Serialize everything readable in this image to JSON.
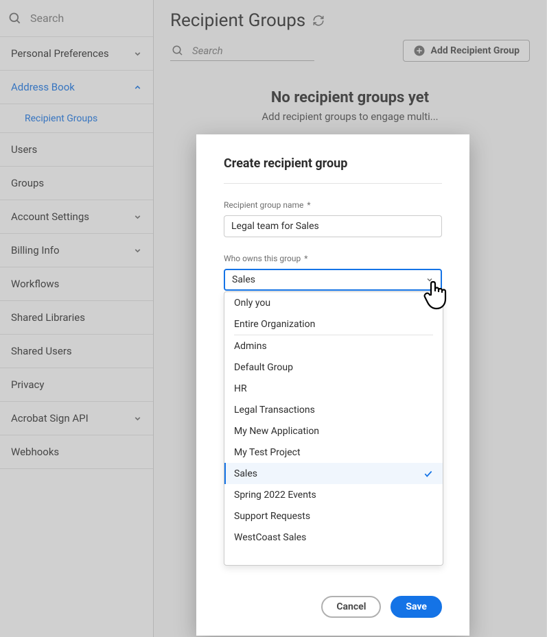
{
  "sidebar": {
    "searchPlaceholder": "Search",
    "items": [
      {
        "label": "Personal Preferences",
        "hasChevron": "down"
      },
      {
        "label": "Address Book",
        "hasChevron": "up",
        "active": true
      },
      {
        "label": "Users"
      },
      {
        "label": "Groups"
      },
      {
        "label": "Account Settings",
        "hasChevron": "down"
      },
      {
        "label": "Billing Info",
        "hasChevron": "down"
      },
      {
        "label": "Workflows"
      },
      {
        "label": "Shared Libraries"
      },
      {
        "label": "Shared Users"
      },
      {
        "label": "Privacy"
      },
      {
        "label": "Acrobat Sign API",
        "hasChevron": "down"
      },
      {
        "label": "Webhooks"
      }
    ],
    "subItem": "Recipient Groups"
  },
  "main": {
    "title": "Recipient Groups",
    "searchPlaceholder": "Search",
    "addButton": "Add Recipient Group",
    "emptyTitle": "No recipient groups yet",
    "emptySubtitle": "Add recipient groups to engage multi..."
  },
  "modal": {
    "title": "Create recipient group",
    "nameLabel": "Recipient group name",
    "nameValue": "Legal team for Sales",
    "ownerLabel": "Who owns this group",
    "ownerValue": "Sales",
    "cancel": "Cancel",
    "save": "Save"
  },
  "dropdown": {
    "options": [
      "Only you",
      "Entire Organization",
      "Admins",
      "Default Group",
      "HR",
      "Legal Transactions",
      "My New Application",
      "My Test Project",
      "Sales",
      "Spring 2022 Events",
      "Support Requests",
      "WestCoast Sales"
    ],
    "selected": "Sales"
  }
}
